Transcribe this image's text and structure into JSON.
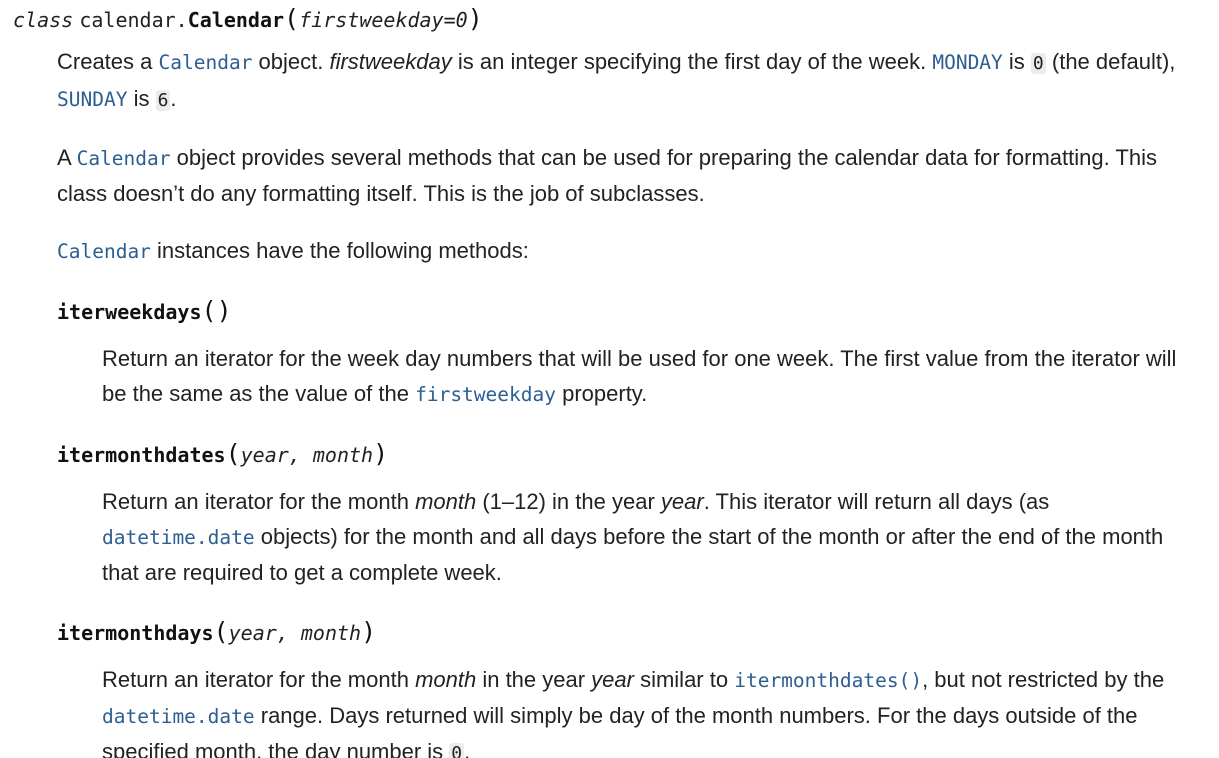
{
  "class_sig": {
    "keyword": "class",
    "module": "calendar.",
    "name": "Calendar",
    "open": "(",
    "param": "firstweekday=0",
    "close": ")"
  },
  "class_desc": {
    "p1": {
      "t1": "Creates a ",
      "ref1": "Calendar",
      "t2": " object. ",
      "em1": "firstweekday",
      "t3": " is an integer specifying the first day of the week. ",
      "ref2": "MONDAY",
      "t4": " is ",
      "lit1": "0",
      "t5": " (the default), ",
      "ref3": "SUNDAY",
      "t6": " is ",
      "lit2": "6",
      "t7": "."
    },
    "p2": {
      "t1": "A ",
      "ref1": "Calendar",
      "t2": " object provides several methods that can be used for preparing the calendar data for formatting. This class doesn’t do any formatting itself. This is the job of subclasses."
    },
    "p3": {
      "ref1": "Calendar",
      "t1": " instances have the following methods:"
    }
  },
  "methods": [
    {
      "name": "iterweekdays",
      "open": "(",
      "params": "",
      "close": ")",
      "desc": {
        "t1": "Return an iterator for the week day numbers that will be used for one week. The first value from the iterator will be the same as the value of the ",
        "ref1": "firstweekday",
        "t2": " property."
      }
    },
    {
      "name": "itermonthdates",
      "open": "(",
      "params": "year, month",
      "close": ")",
      "desc": {
        "t1": "Return an iterator for the month ",
        "em1": "month",
        "t2": " (1–12) in the year ",
        "em2": "year",
        "t3": ". This iterator will return all days (as ",
        "ref1": "datetime.date",
        "t4": " objects) for the month and all days before the start of the month or after the end of the month that are required to get a complete week."
      }
    },
    {
      "name": "itermonthdays",
      "open": "(",
      "params": "year, month",
      "close": ")",
      "desc": {
        "t1": "Return an iterator for the month ",
        "em1": "month",
        "t2": " in the year ",
        "em2": "year",
        "t3": " similar to ",
        "ref1": "itermonthdates()",
        "t4": ", but not restricted by the ",
        "ref2": "datetime.date",
        "t5": " range. Days returned will simply be day of the month numbers. For the days outside of the specified month, the day number is ",
        "lit1": "0",
        "t6": "."
      }
    }
  ]
}
